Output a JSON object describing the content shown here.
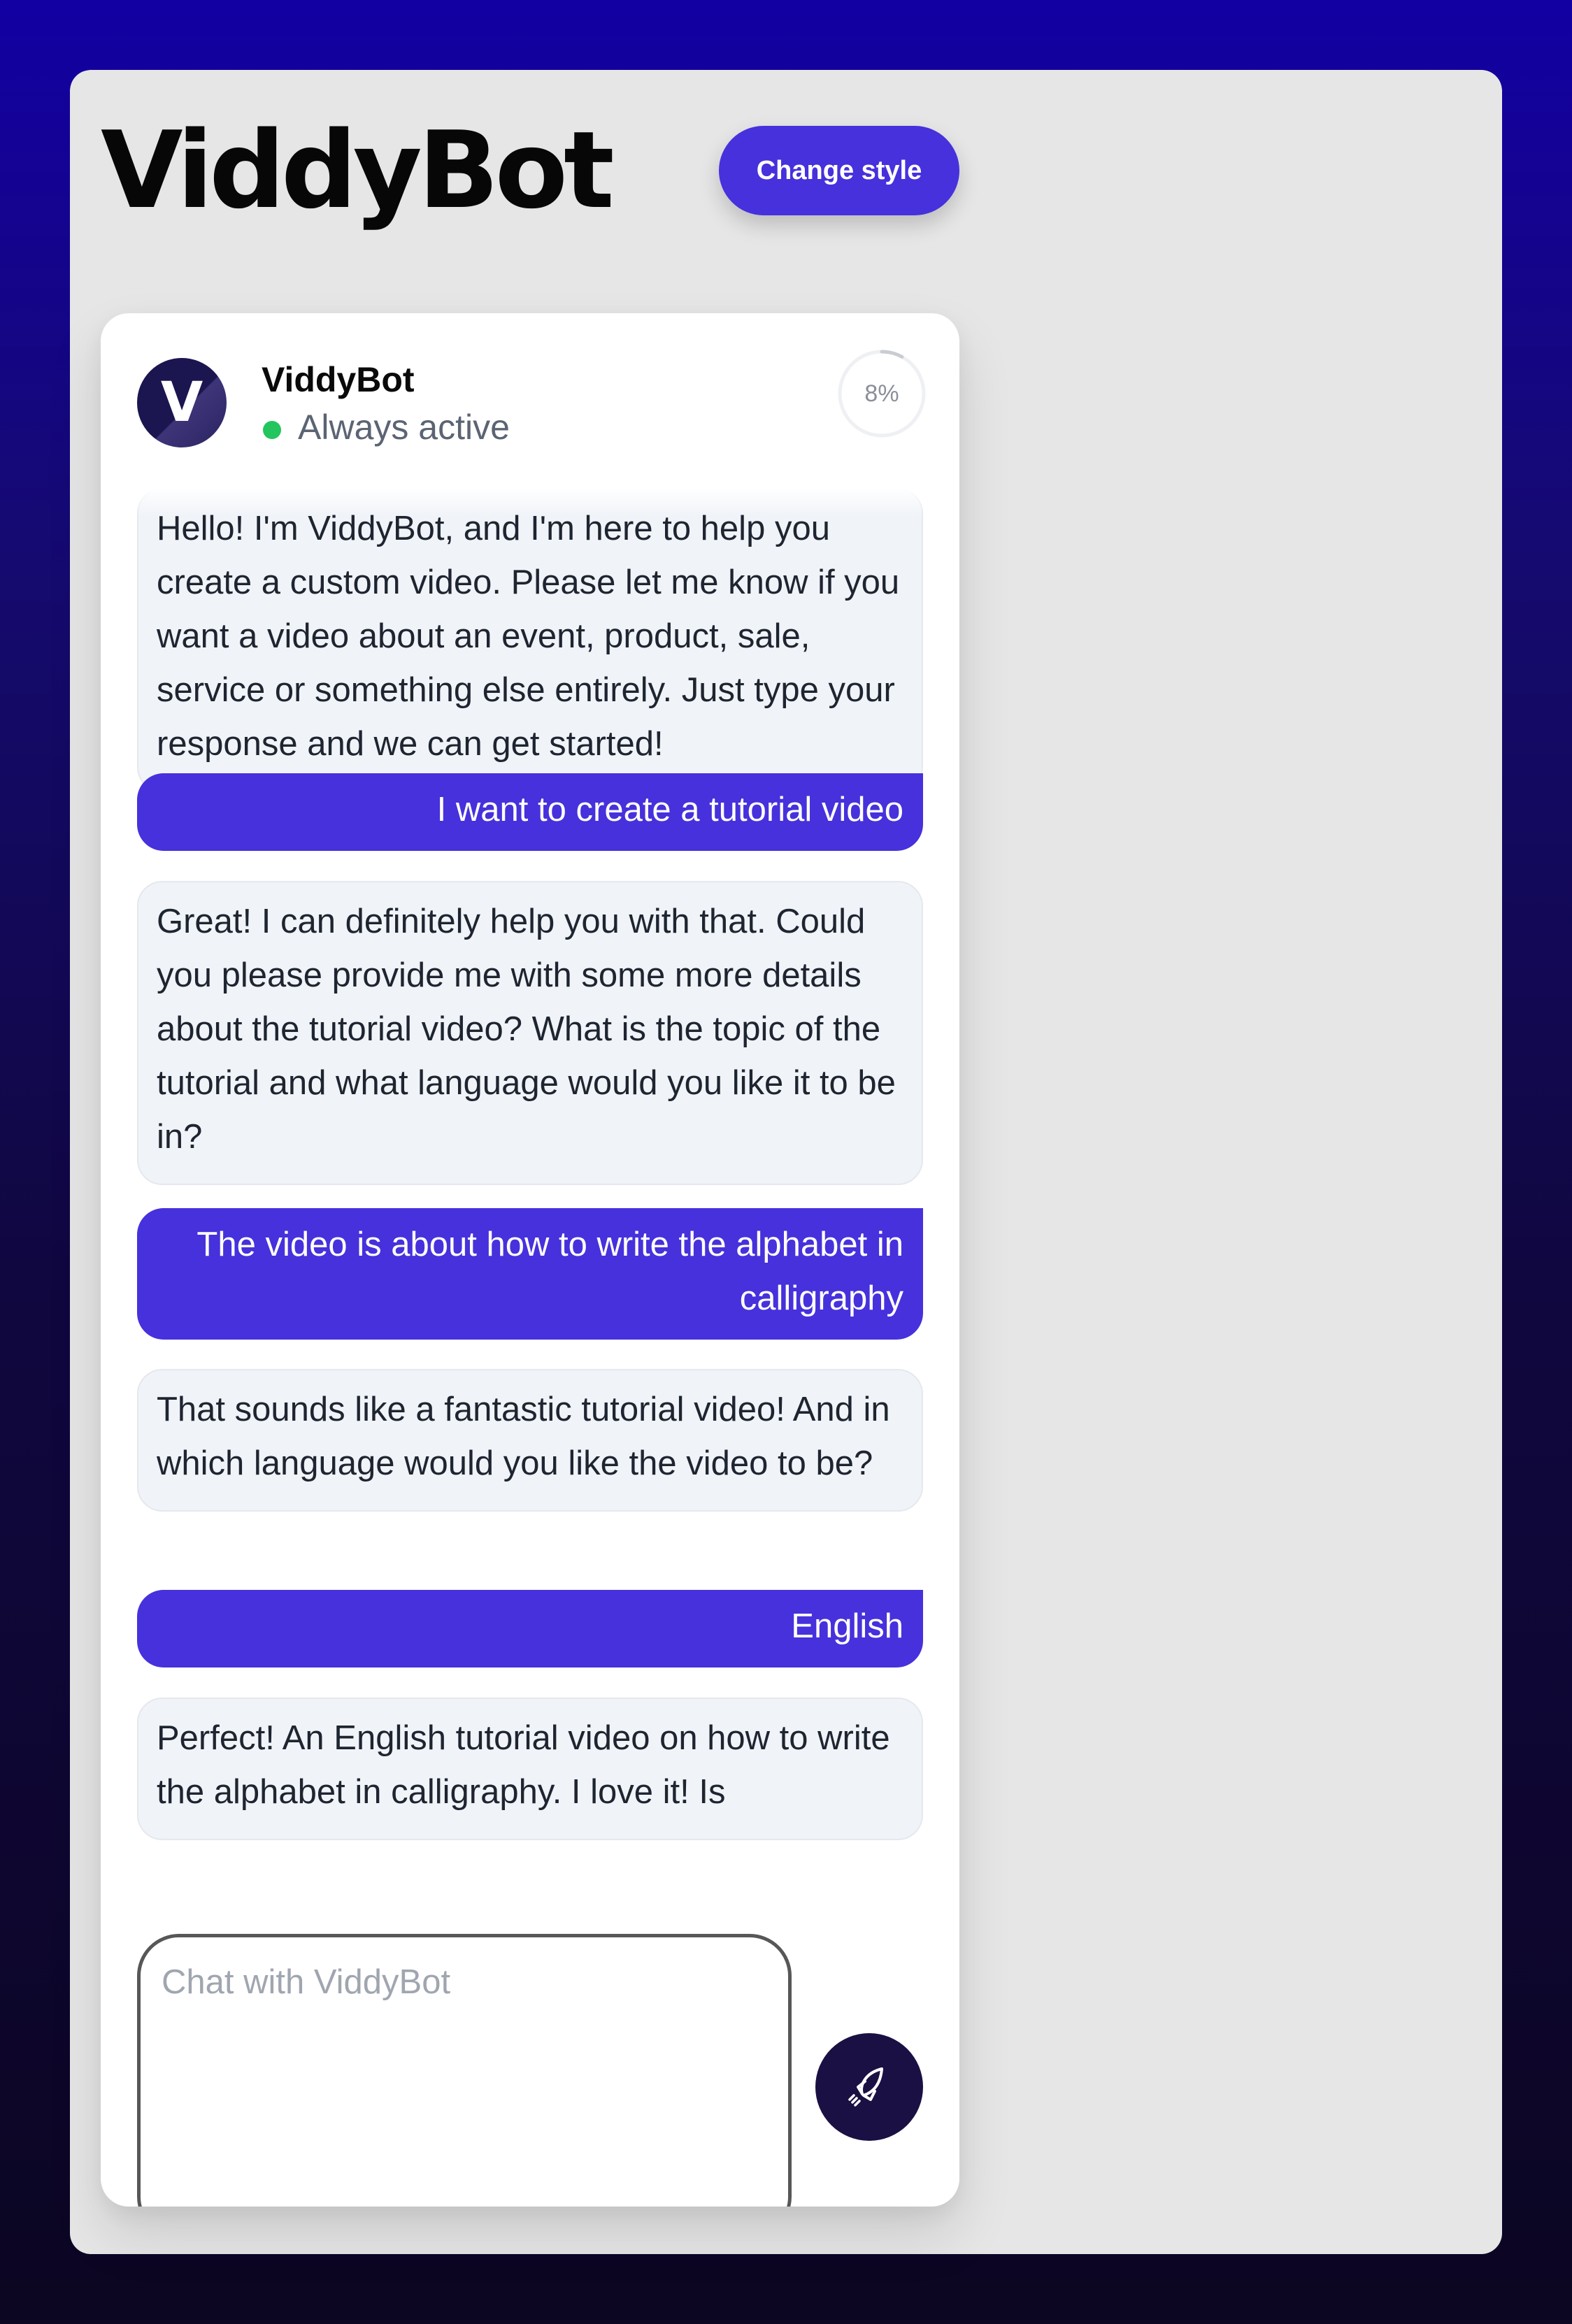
{
  "app": {
    "title": "ViddyBot",
    "change_style_label": "Change style"
  },
  "chat_header": {
    "avatar_letter": "V",
    "bot_name": "ViddyBot",
    "status": "Always active",
    "progress_label": "8%",
    "progress_value": 0.08
  },
  "messages": [
    {
      "role": "bot",
      "text": "Hello! I'm ViddyBot, and I'm here to help you create a custom video. Please let me know if you want a video about an event, product, sale, service or something else entirely. Just type your response and we can get started!"
    },
    {
      "role": "user",
      "text": "I want to create a tutorial video"
    },
    {
      "role": "bot",
      "text": "Great! I can definitely help you with that. Could you please provide me with some more details about the tutorial video? What is the topic of the tutorial and what language would you like it to be in?"
    },
    {
      "role": "user",
      "text": "The video is about how to write the alphabet in calligraphy"
    },
    {
      "role": "bot",
      "text": "That sounds like a fantastic tutorial video! And in which language would you like the video to be?"
    },
    {
      "role": "user",
      "text": "English"
    },
    {
      "role": "bot",
      "text": "Perfect! An English tutorial video on how to write the alphabet in calligraphy. I love it! Is"
    }
  ],
  "composer": {
    "placeholder": "Chat with ViddyBot",
    "value": "",
    "send_icon": "rocket-icon"
  },
  "colors": {
    "accent": "#4631dc",
    "bot_bubble": "#f0f3f8",
    "status_online": "#22c55e",
    "send_button": "#1a1044"
  }
}
